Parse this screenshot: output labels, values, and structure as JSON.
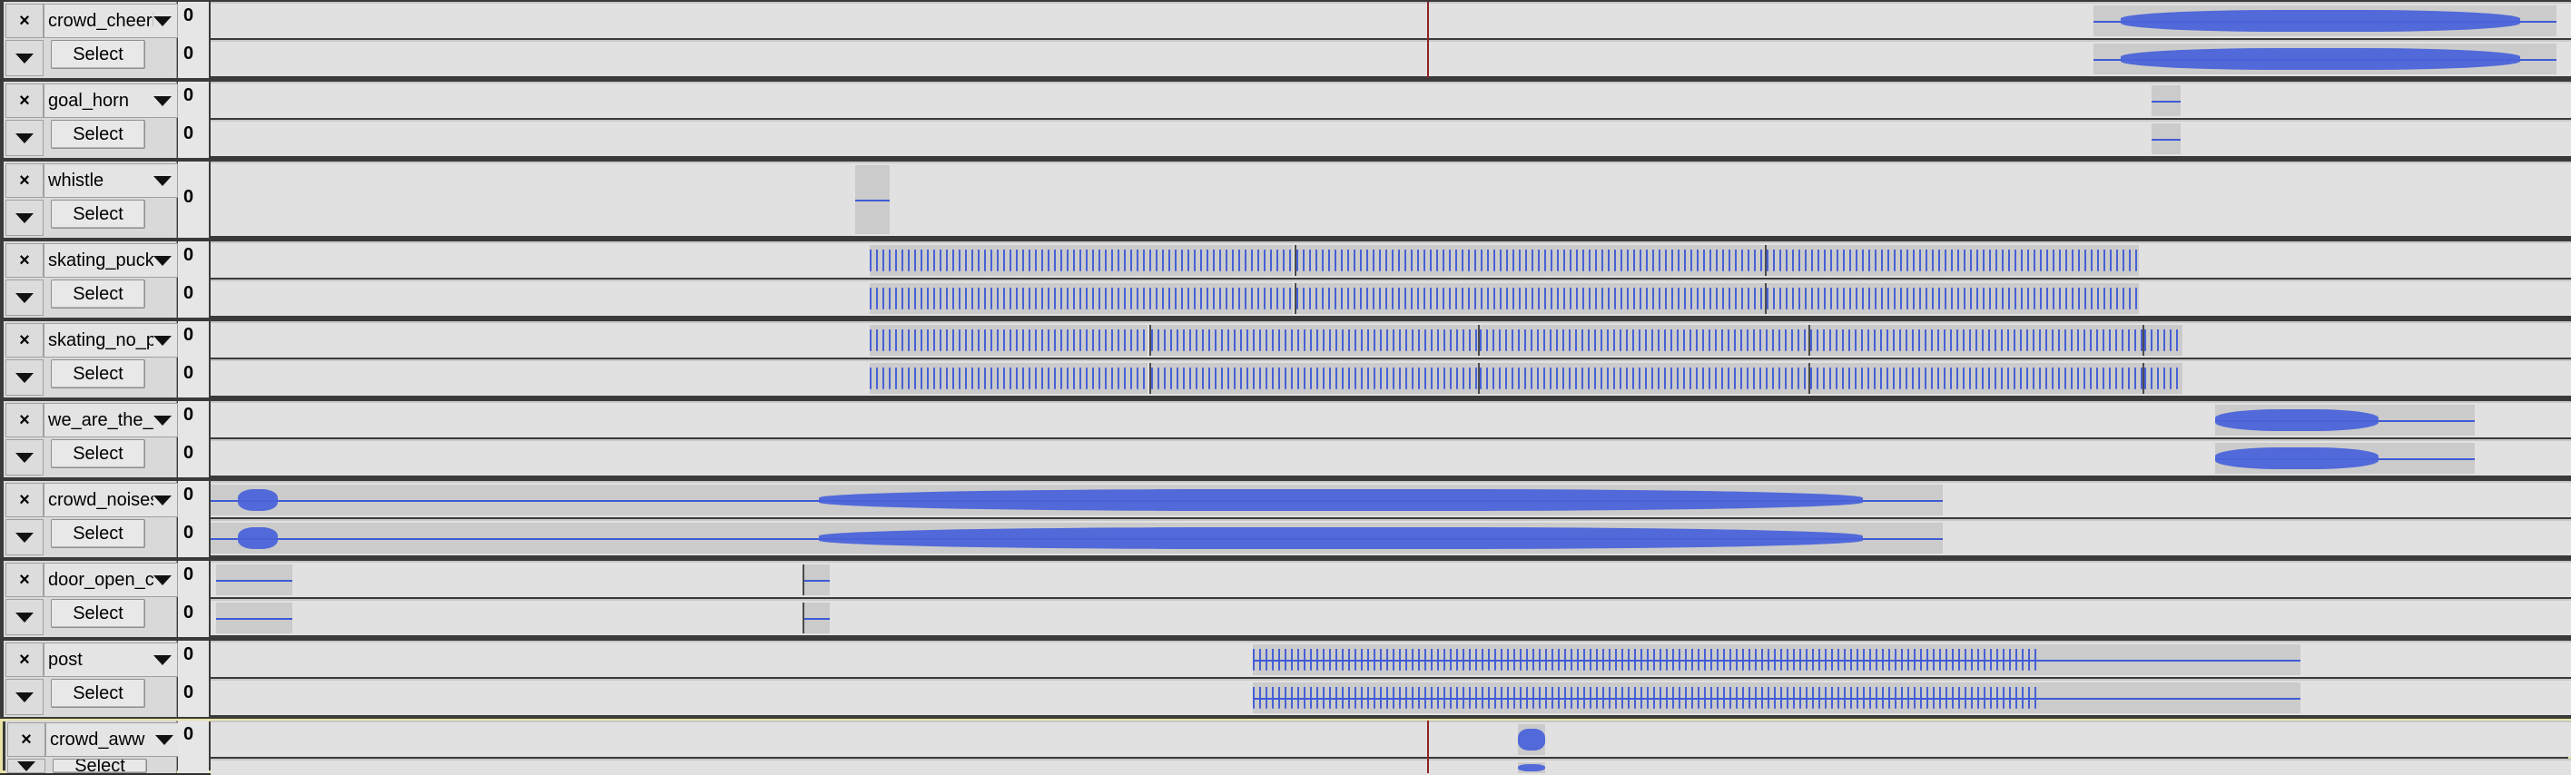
{
  "app": {
    "window": "Audio editor track panel"
  },
  "close_glyph": "×",
  "vruler_label": "0",
  "select_label": "Select",
  "colors": {
    "wave": "#3f5ad6",
    "clip": "#cbcbcb",
    "lane": "#e1e1e1",
    "selected_border": "#e9e2a6"
  },
  "tracks": [
    {
      "name": "crowd_cheeri",
      "selected": false
    },
    {
      "name": "goal_horn",
      "selected": false
    },
    {
      "name": "whistle",
      "selected": false
    },
    {
      "name": "skating_puck",
      "selected": false
    },
    {
      "name": "skating_no_p",
      "selected": false
    },
    {
      "name": "we_are_the_c",
      "selected": false
    },
    {
      "name": "crowd_noises",
      "selected": false
    },
    {
      "name": "door_open_cl",
      "selected": false
    },
    {
      "name": "post",
      "selected": false
    },
    {
      "name": "crowd_aww",
      "selected": true
    }
  ]
}
